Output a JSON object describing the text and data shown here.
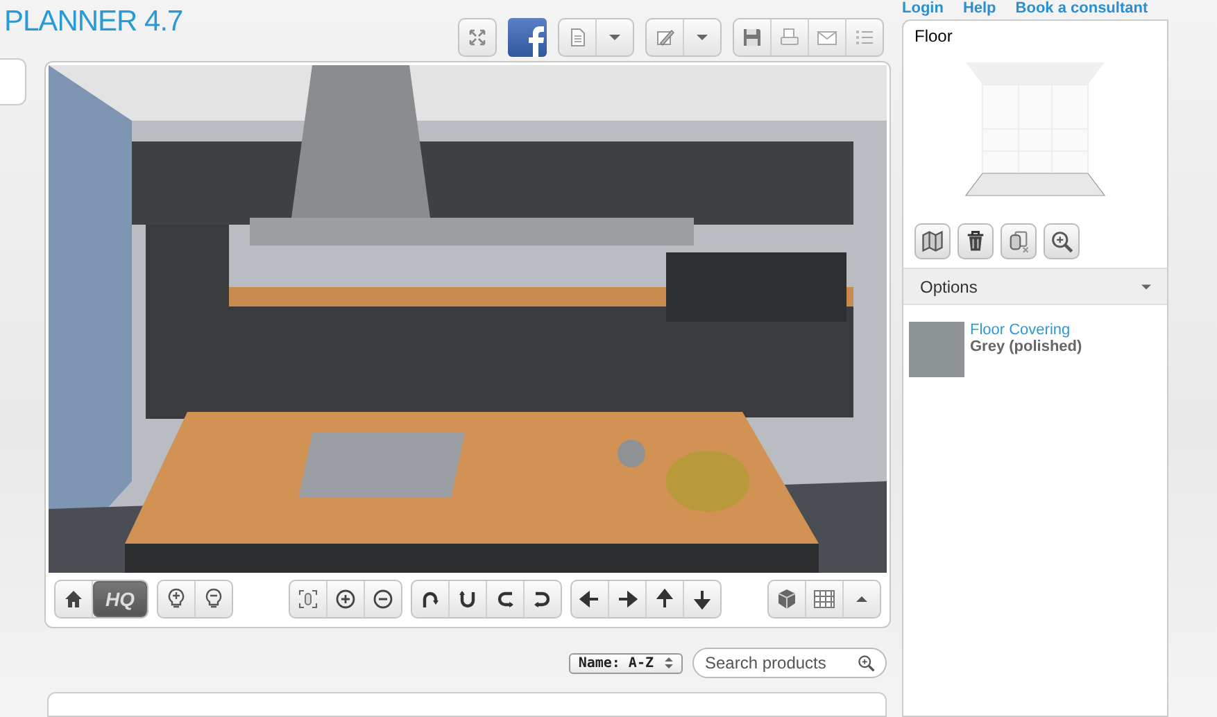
{
  "header": {
    "title": "PLANNER 4.7",
    "links": [
      "Login",
      "Help",
      "Book a consultant"
    ]
  },
  "view_toolbar": {
    "hq": {
      "label": "HQ",
      "selected": true
    }
  },
  "product_bar": {
    "sort": "Name: A-Z",
    "search": {
      "placeholder": "Search products"
    }
  },
  "side_panel": {
    "tab": "Floor",
    "options": {
      "title": "Options",
      "expanded": true
    },
    "material": {
      "title": "Floor Covering",
      "value": "Grey (polished)"
    }
  }
}
